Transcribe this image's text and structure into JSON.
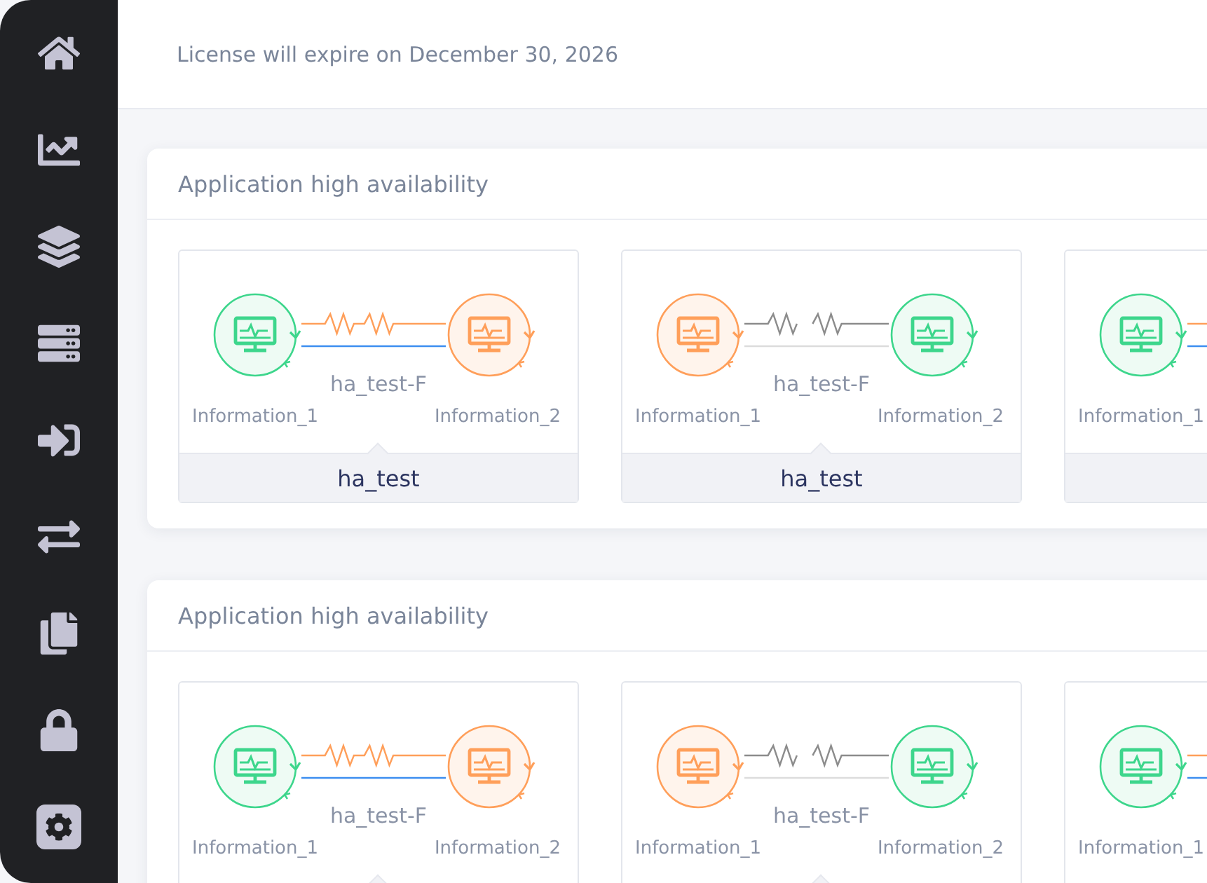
{
  "header": {
    "license_notice": "License will expire on December 30, 2026"
  },
  "sections": [
    {
      "title": "Application high availability",
      "cards": [
        {
          "node_1": {
            "label": "Information_1",
            "active": true
          },
          "node_2": {
            "label": "Information_2",
            "active": false
          },
          "link": {
            "label": "ha_test-F",
            "connected": true
          },
          "name": "ha_test"
        },
        {
          "node_1": {
            "label": "Information_1",
            "active": false
          },
          "node_2": {
            "label": "Information_2",
            "active": true
          },
          "link": {
            "label": "ha_test-F",
            "connected": false
          },
          "name": "ha_test"
        },
        {
          "node_1": {
            "label": "Information_1",
            "active": true
          },
          "link": {
            "connected": true
          }
        }
      ]
    },
    {
      "title": "Application high availability",
      "cards": [
        {
          "node_1": {
            "label": "Information_1",
            "active": true
          },
          "node_2": {
            "label": "Information_2",
            "active": false
          },
          "link": {
            "label": "ha_test-F",
            "connected": true
          }
        },
        {
          "node_1": {
            "label": "Information_1",
            "active": false
          },
          "node_2": {
            "label": "Information_2",
            "active": true
          },
          "link": {
            "label": "ha_test-F",
            "connected": false
          }
        },
        {
          "node_1": {
            "label": "Information_1",
            "active": true
          },
          "link": {
            "connected": true
          }
        }
      ]
    }
  ]
}
